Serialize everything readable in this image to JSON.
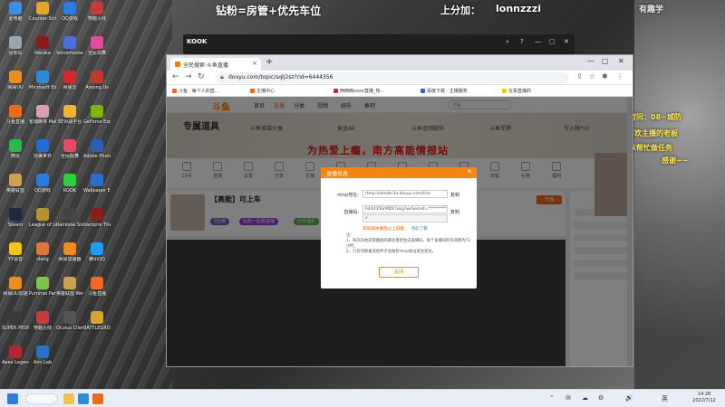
{
  "overlays": {
    "top_center": "钻粉=房管+优先车位",
    "top_right_label": "上分加：",
    "top_right_id": "lonnzzzi",
    "far_right_top": "有趣学",
    "right_lines": [
      "直播时间：08~城防",
      "喜欢主播的老板",
      "可以帮忙做任务",
      "感谢~~"
    ]
  },
  "desktop_icons": [
    {
      "label": "此电脑",
      "color": "#3a8ee6"
    },
    {
      "label": "Counter-Strike",
      "color": "#e0a72a"
    },
    {
      "label": "QQ游戏",
      "color": "#2a7ae6"
    },
    {
      "label": "穿越火线",
      "color": "#c73b3b"
    },
    {
      "label": "回收站",
      "color": "#9aa6b2"
    },
    {
      "label": "Naraka",
      "color": "#8b1b1b"
    },
    {
      "label": "Voicemeeter Banana",
      "color": "#4d6de0"
    },
    {
      "label": "全民劲舞",
      "color": "#e24c9c"
    },
    {
      "label": "网易UU",
      "color": "#ed8c1f"
    },
    {
      "label": "Microsoft Edge",
      "color": "#2d8bd8"
    },
    {
      "label": "网易云",
      "color": "#d7262c"
    },
    {
      "label": "Among Us",
      "color": "#c0392b"
    },
    {
      "label": "斗鱼直播",
      "color": "#f06a1a"
    },
    {
      "label": "雀魂麻将 Mahjong",
      "color": "#d8a0b8"
    },
    {
      "label": "5E对战平台",
      "color": "#f2b233"
    },
    {
      "label": "GeForce Experience",
      "color": "#76b900"
    },
    {
      "label": "微信",
      "color": "#29b94a"
    },
    {
      "label": "完美世界",
      "color": "#1f6fd6"
    },
    {
      "label": "全民街舞",
      "color": "#e54b66"
    },
    {
      "label": "Adobe Photoshop",
      "color": "#2b5fb5"
    },
    {
      "label": "英雄联盟",
      "color": "#c9a34d"
    },
    {
      "label": "QQ游戏",
      "color": "#2a7ae6"
    },
    {
      "label": "KOOK",
      "color": "#2ed03a"
    },
    {
      "label": "Wallpaper Engine",
      "color": "#2a6fd0"
    },
    {
      "label": "Steam",
      "color": "#1b2a47"
    },
    {
      "label": "League of Legends",
      "color": "#b8912f"
    },
    {
      "label": "Rainbow Six",
      "color": "#444444"
    },
    {
      "label": "Vampire The Masq",
      "color": "#8a1c1c"
    },
    {
      "label": "YY语音",
      "color": "#f5c518"
    },
    {
      "label": "slang",
      "color": "#e0743a"
    },
    {
      "label": "网易加速器",
      "color": "#ed8c1f"
    },
    {
      "label": "腾讯QQ",
      "color": "#1d9bf0"
    },
    {
      "label": "网易UU加速",
      "color": "#f08c1a"
    },
    {
      "label": "Pummel Party",
      "color": "#7dc34a"
    },
    {
      "label": "英雄联盟 WeGame",
      "color": "#c9a34d"
    },
    {
      "label": "斗鱼直播",
      "color": "#f06a1a"
    },
    {
      "label": "SUPER PEOPLE CBT",
      "color": "#3a3a3a"
    },
    {
      "label": "穿越火线",
      "color": "#c73b3b"
    },
    {
      "label": "Oculus Client",
      "color": "#555555"
    },
    {
      "label": "BATTLEGROUNDS",
      "color": "#d8a52a"
    },
    {
      "label": "Apex Legends",
      "color": "#b8262a"
    },
    {
      "label": "Aim Lab",
      "color": "#2a72c7"
    }
  ],
  "obs": {
    "logo": "KOOK",
    "controls": [
      "⌕",
      "?",
      "—",
      "▢",
      "✕"
    ]
  },
  "browser": {
    "tab_title": "全民搜索·斗鱼直播",
    "url": "douyu.com/topic/sqlj2sz?rid=6444356",
    "bookmarks": [
      {
        "label": "斗鱼 · 每个人的直...",
        "color": "#f06a1a"
      },
      {
        "label": "主播中心",
        "color": "#f06a1a"
      },
      {
        "label": "两两两xxxx直播_热...",
        "color": "#d7262c"
      },
      {
        "label": "百度下载 · 主播服务",
        "color": "#2d62e0"
      },
      {
        "label": "在看直播的",
        "color": "#f5c518"
      }
    ],
    "site": {
      "logo": "斗鱼",
      "nav": [
        "首页",
        "直播",
        "分类",
        "视频",
        "娱乐",
        "鱼吧"
      ],
      "active_nav": "直播",
      "search_placeholder": "搜索",
      "banner_title": "专属道具",
      "banner_tabs": [
        "斗鱼英雄头像",
        "黄金AK",
        "斗鱼金刚腿饰",
        "斗鱼军牌",
        "军火箱*10"
      ],
      "banner_slogan": "为热爱上瘾，南方高能情报站",
      "tools": [
        "12月",
        "直播",
        "设置",
        "分享",
        "主播",
        "房管",
        "任务",
        "商城",
        "签到",
        "活动",
        "日程",
        "礼物",
        "福利"
      ],
      "room_title": "【高能】可上车",
      "room_badges": [
        "3分钟",
        "钻粉一起看直播",
        "分享福利"
      ],
      "open_button": "开播"
    },
    "modal": {
      "title": "直播信息",
      "close": "✕",
      "rtmp_label": "rtmp地址:",
      "rtmp_value": "rtmp://sendtc3a.douyu.com/live",
      "stream_label": "直播码:",
      "stream_value": "6444356rMDK?ukg?wsSecret=**********",
      "stream_select": "v",
      "copy1": "复制",
      "copy2": "复制",
      "warning": "获取媒体播放以上链接，",
      "help_link": "点此了解",
      "notes": [
        "注：",
        "1、每次开始获取播放码都会重新生成直播码，每个直播间的有效期为72小时。",
        "2、只有切换推流组件才会推荐rtmp地址发生变化。"
      ],
      "close_button": "关闭"
    }
  },
  "taskbar": {
    "clock_time": "14:28",
    "clock_date": "2022/7/12",
    "tray": [
      "⌃",
      "✉",
      "☁",
      "⚙",
      "🔊",
      "英"
    ]
  }
}
